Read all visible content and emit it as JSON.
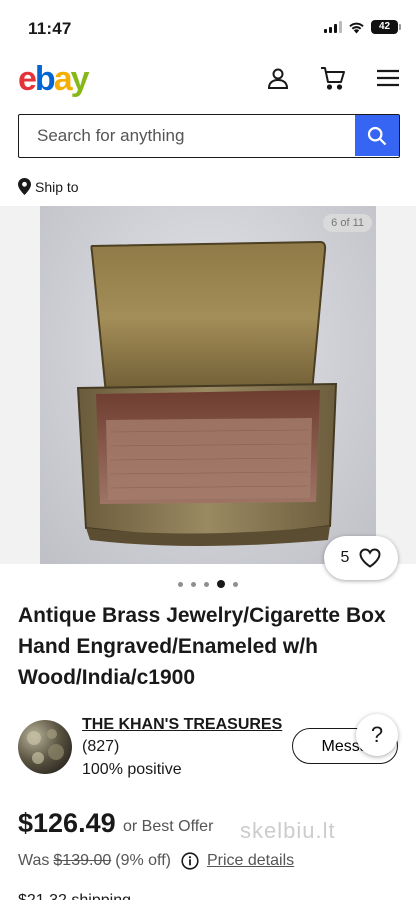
{
  "status": {
    "time": "11:47",
    "battery": "42"
  },
  "header": {
    "logo": {
      "e": "e",
      "b": "b",
      "a": "a",
      "y": "y"
    },
    "icons": [
      "user-icon",
      "cart-icon",
      "menu-icon"
    ]
  },
  "search": {
    "placeholder": "Search for anything",
    "icon": "search-icon"
  },
  "ship_to": {
    "label": "Ship to"
  },
  "gallery": {
    "counter": "6 of 11",
    "watch_count": "5",
    "dots_total": 5,
    "dots_active": 4
  },
  "listing": {
    "title": "Antique Brass Jewelry/Cigarette Box Hand Engraved/Enameled w/h Wood/India/c1900"
  },
  "seller": {
    "name": "THE KHAN'S TREASURES",
    "feedback_count": "(827)",
    "positive": "100% positive",
    "message_label": "Message",
    "help_label": "?"
  },
  "price": {
    "current": "$126.49",
    "best_offer": "or Best Offer",
    "was_label": "Was",
    "was_price": "$139.00",
    "discount": "(9% off)",
    "details_link": "Price details",
    "shipping": "$21.32 shipping"
  },
  "watermark": "skelbiu.lt",
  "colors": {
    "accent": "#3665f3",
    "ebay_red": "#e53238",
    "ebay_blue": "#0064d2",
    "ebay_yellow": "#f5af02",
    "ebay_green": "#86b817"
  }
}
